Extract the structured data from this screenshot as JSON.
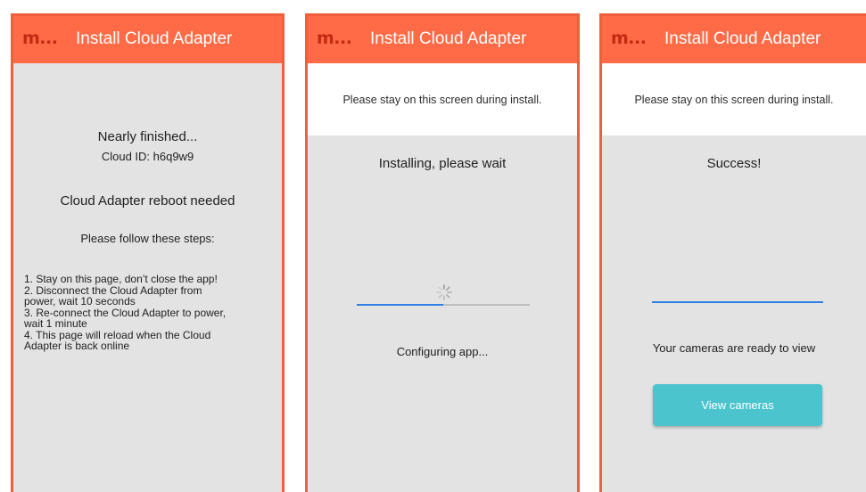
{
  "brand": {
    "logo_text": "m...",
    "accent_color": "#ff6b47",
    "border_color": "#ee5f3c",
    "button_color": "#4cc4ce",
    "progress_color": "#2f7fe6"
  },
  "screens": [
    {
      "title": "Install Cloud Adapter",
      "heading": "Nearly finished...",
      "cloud_id": "Cloud ID: h6q9w9",
      "subheading": "Cloud Adapter reboot needed",
      "instruction": "Please follow these steps:",
      "steps": [
        "1. Stay on this page, don’t close the app!",
        "2. Disconnect the Cloud Adapter from",
        "power, wait 10 seconds",
        "3. Re-connect the Cloud Adapter to power,",
        "wait 1 minute",
        "4. This page will reload when the Cloud",
        "Adapter is back online"
      ]
    },
    {
      "title": "Install Cloud Adapter",
      "notice": "Please stay on this screen during install.",
      "heading": "Installing, please wait",
      "progress": 0.5,
      "status": "Configuring app...",
      "spinner_icon": "loading-spinner-icon"
    },
    {
      "title": "Install Cloud Adapter",
      "notice": "Please stay on this screen during install.",
      "heading": "Success!",
      "progress": 1.0,
      "message": "Your cameras are ready to view",
      "button_label": "View cameras"
    }
  ]
}
